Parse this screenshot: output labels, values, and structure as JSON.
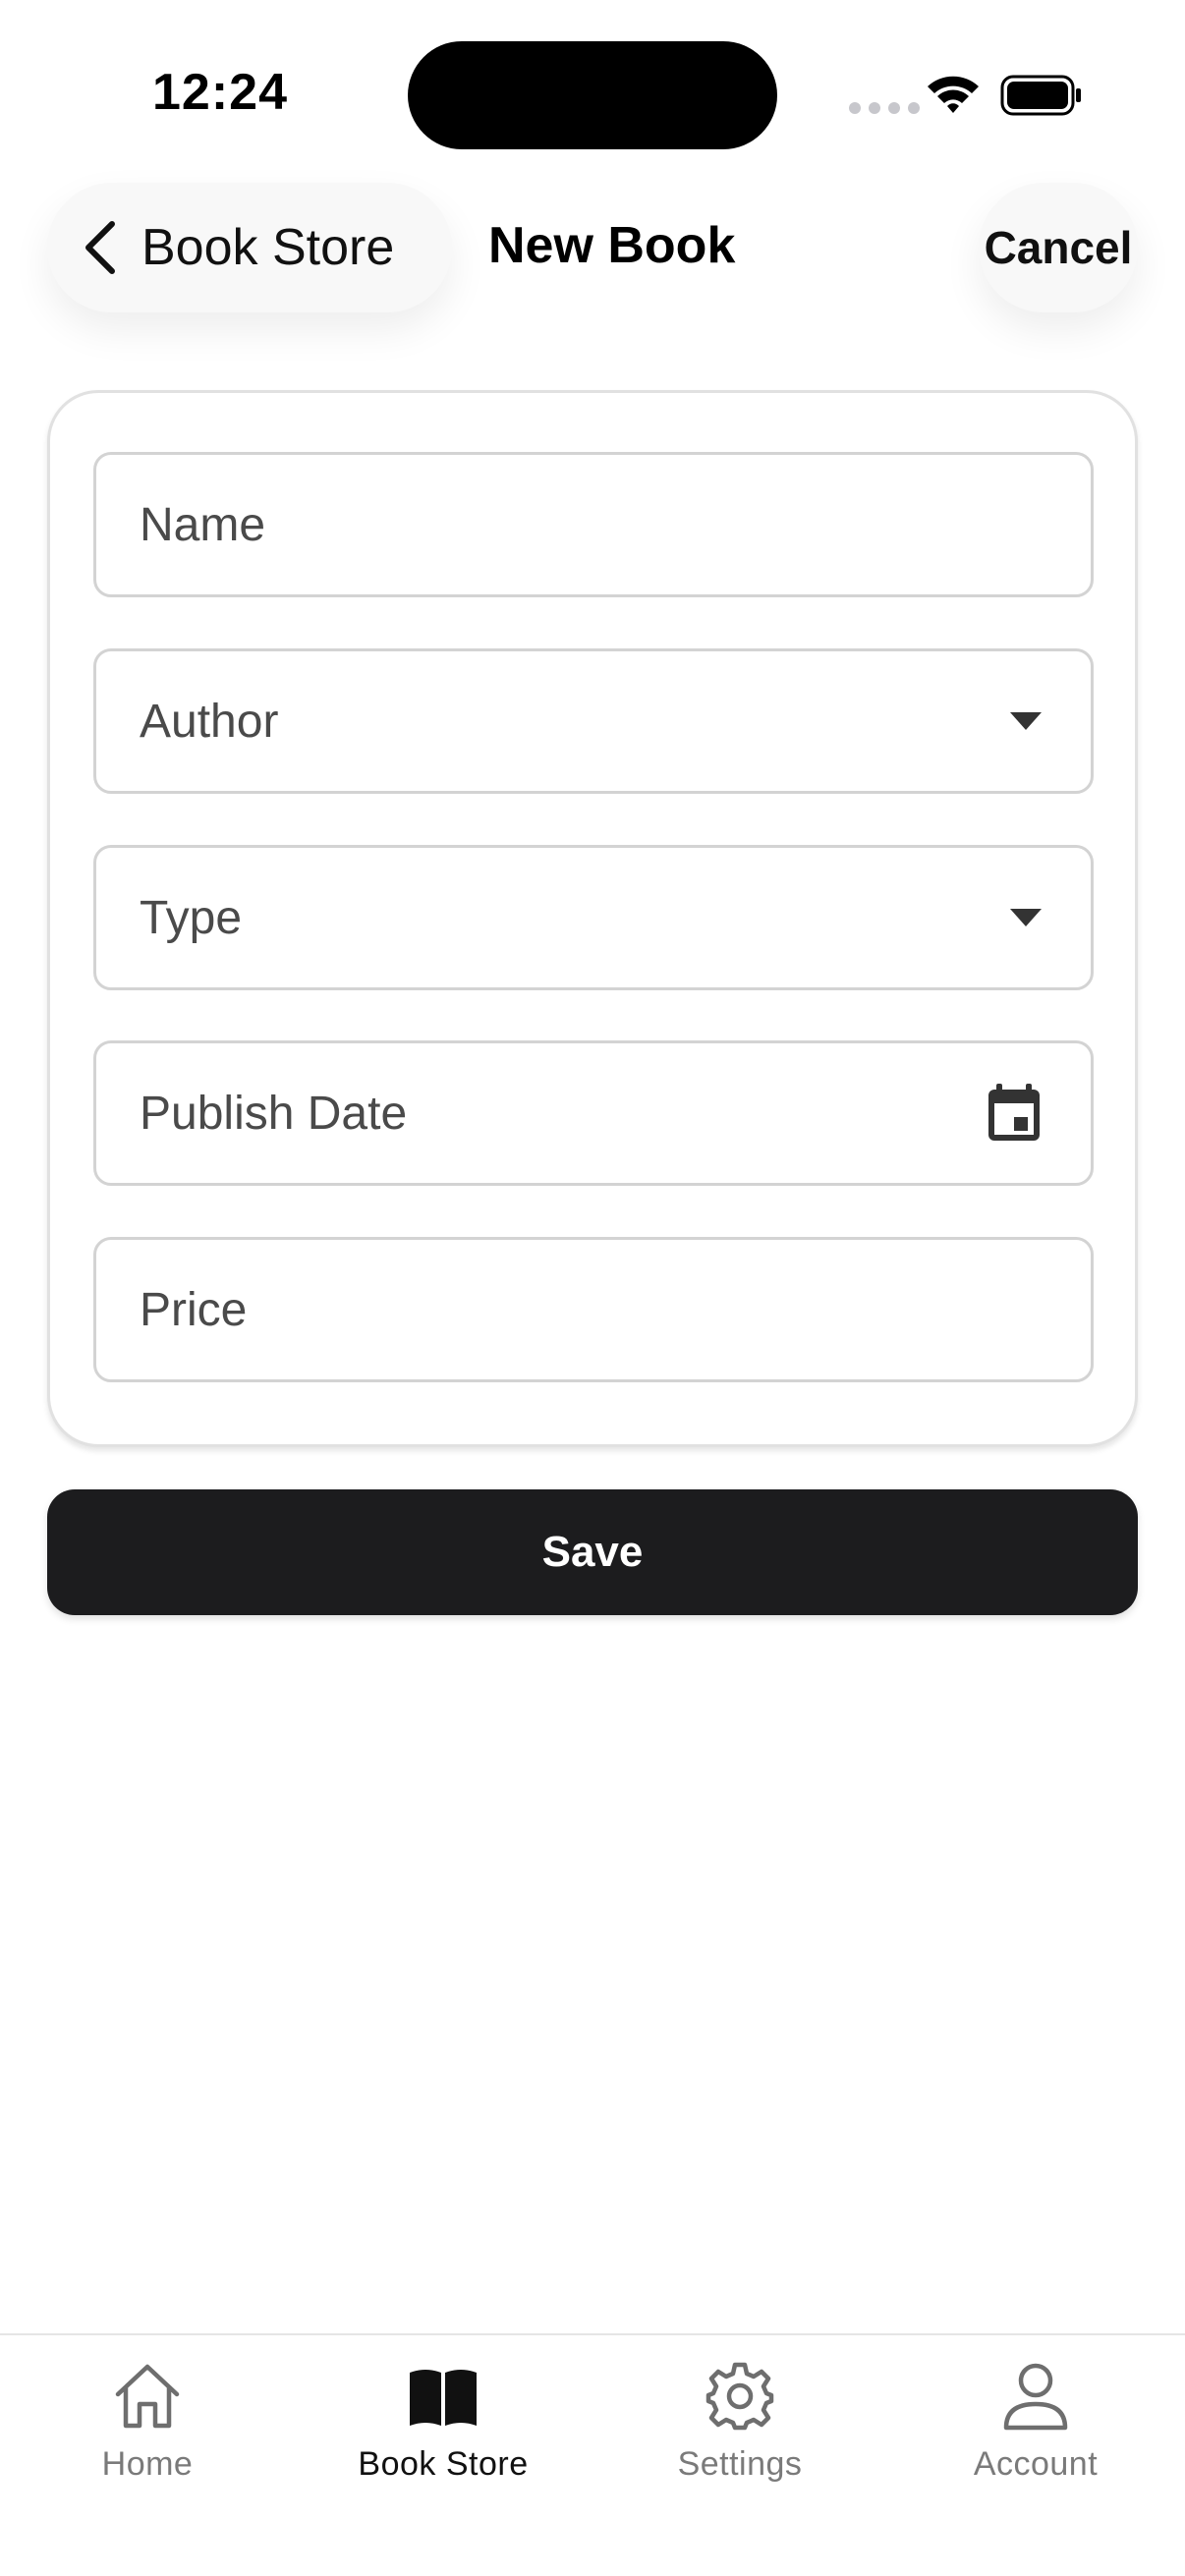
{
  "status_bar": {
    "time": "12:24"
  },
  "nav": {
    "back_label": "Book Store",
    "title": "New Book",
    "cancel_label": "Cancel"
  },
  "form": {
    "fields": [
      {
        "label": "Name",
        "kind": "text"
      },
      {
        "label": "Author",
        "kind": "select"
      },
      {
        "label": "Type",
        "kind": "select"
      },
      {
        "label": "Publish Date",
        "kind": "date"
      },
      {
        "label": "Price",
        "kind": "text"
      }
    ],
    "save_label": "Save"
  },
  "tab_bar": {
    "tabs": [
      {
        "label": "Home",
        "icon": "house-icon"
      },
      {
        "label": "Book Store",
        "icon": "book-icon",
        "active": true
      },
      {
        "label": "Settings",
        "icon": "gear-icon"
      },
      {
        "label": "Account",
        "icon": "person-icon"
      }
    ]
  },
  "colors": {
    "primary_button": "#1c1c1e",
    "field_border": "#d3d3d3",
    "inactive_tab": "#7a7a7a"
  }
}
